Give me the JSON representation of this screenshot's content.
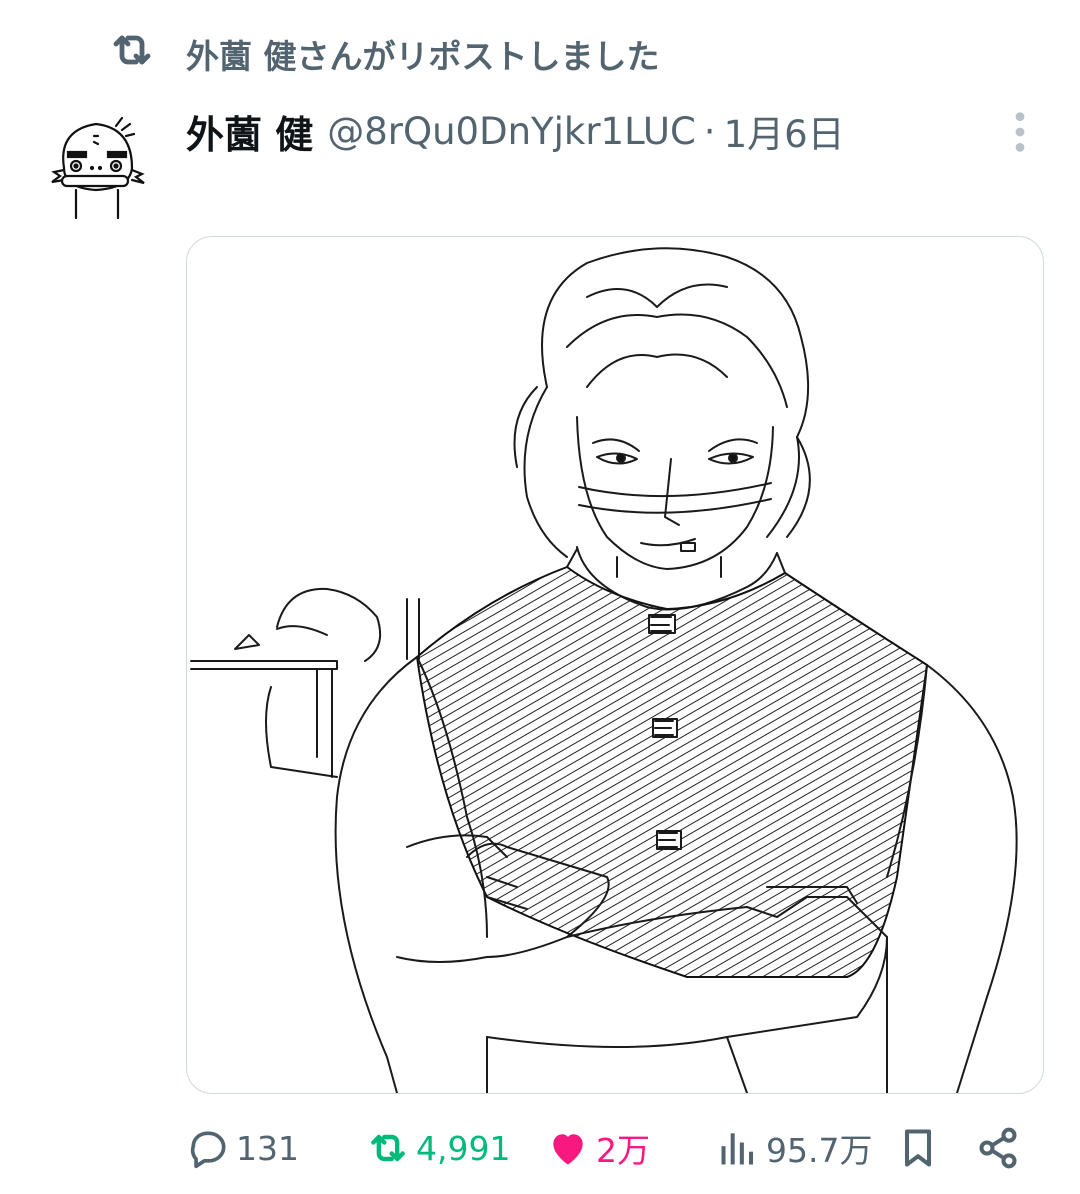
{
  "repost_banner": {
    "text": "外薗 健さんがリポストしました",
    "icon": "repost-icon"
  },
  "post": {
    "author_name": "外薗 健",
    "handle": "@8rQu0DnYjkr1LUC",
    "separator": "·",
    "date": "1月6日",
    "more_icon": "more-vertical-icon",
    "media": {
      "description_icon": "illustration-image"
    }
  },
  "actions": {
    "replies": "131",
    "reposts": "4,991",
    "likes": "2万",
    "views": "95.7万"
  },
  "colors": {
    "secondary_text": "#536471",
    "repost_green": "#00ba7c",
    "like_pink": "#f91880",
    "border": "#cfd9de"
  }
}
